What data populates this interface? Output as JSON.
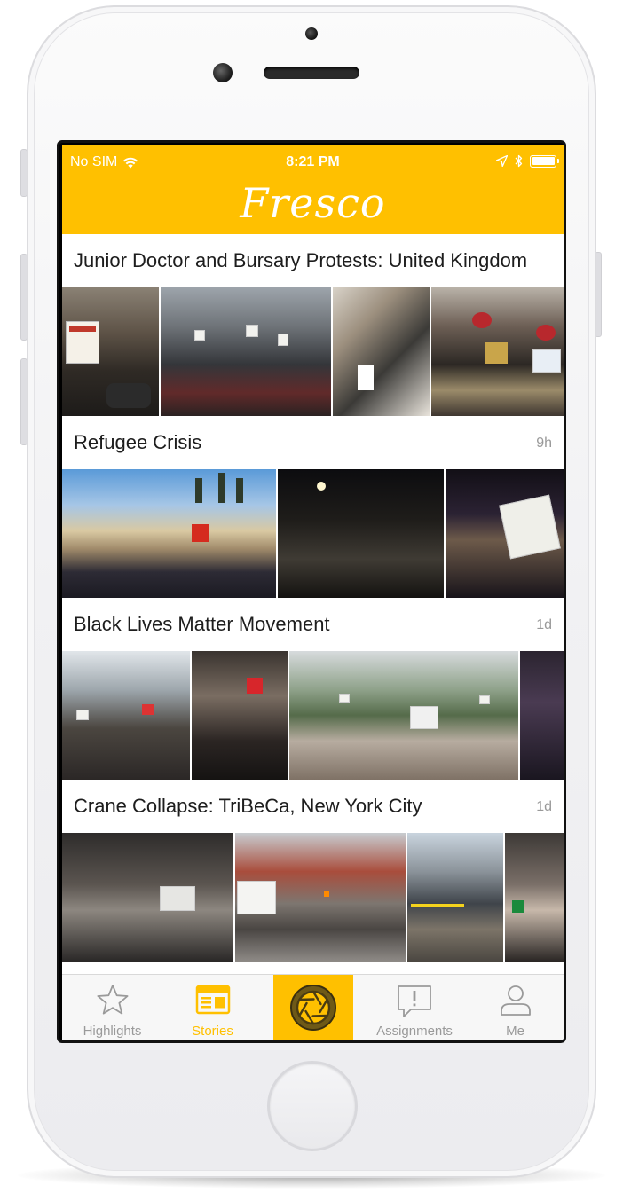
{
  "status_bar": {
    "carrier": "No SIM",
    "time": "8:21 PM"
  },
  "app": {
    "title": "Fresco",
    "accent_color": "#ffc000"
  },
  "stories": [
    {
      "title": "Junior Doctor and Bursary Protests: United Kingdom",
      "time": "",
      "photos": [
        "protest-family-photo",
        "protest-crowd-street-photo",
        "protest-selfie-photo",
        "protest-teddy-bears-photo"
      ]
    },
    {
      "title": "Refugee Crisis",
      "time": "9h",
      "photos": [
        "castle-crowd-flags-photo",
        "night-crowd-photo",
        "night-placard-photo"
      ]
    },
    {
      "title": "Black Lives Matter Movement",
      "time": "1d",
      "photos": [
        "city-march-photo",
        "two-women-photo",
        "park-rally-photo",
        "dark-interior-photo"
      ]
    },
    {
      "title": "Crane Collapse: TriBeCa, New York City",
      "time": "1d",
      "photos": [
        "scaffold-street-photo",
        "crane-street-photo",
        "reporter-camera-photo",
        "sidewalk-photo"
      ]
    }
  ],
  "tab_bar": {
    "items": [
      {
        "label": "Highlights",
        "icon": "star-icon",
        "active": false
      },
      {
        "label": "Stories",
        "icon": "newspaper-icon",
        "active": true
      },
      {
        "label": "",
        "icon": "camera-shutter-icon",
        "active": false
      },
      {
        "label": "Assignments",
        "icon": "alert-bubble-icon",
        "active": false
      },
      {
        "label": "Me",
        "icon": "person-icon",
        "active": false
      }
    ]
  }
}
